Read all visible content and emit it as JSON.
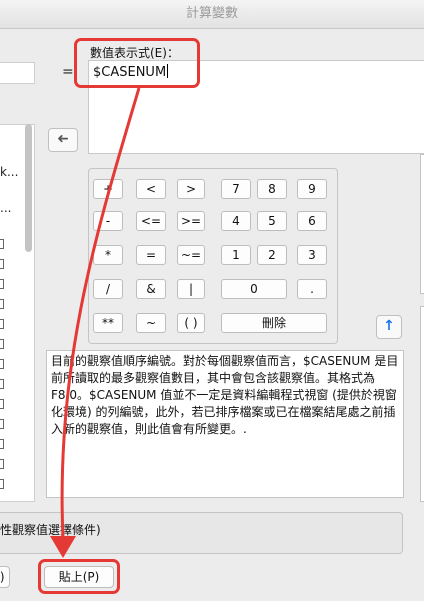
{
  "window": {
    "title": "計算變數"
  },
  "expression": {
    "label": "數值表示式(E)：",
    "value": "$CASENUM",
    "equals": "="
  },
  "variables": {
    "items": [
      "k...",
      "..."
    ]
  },
  "keypad": {
    "keys": [
      "+",
      "<",
      ">",
      "7",
      "8",
      "9",
      "-",
      "<=",
      ">=",
      "4",
      "5",
      "6",
      "*",
      "=",
      "~=",
      "1",
      "2",
      "3",
      "/",
      "&",
      "|",
      "0",
      ".",
      "**",
      "~",
      "( )",
      "刪除"
    ]
  },
  "description": {
    "text": "目前的觀察值順序編號。對於每個觀察值而言，$CASENUM 是目前所讀取的最多觀察值數目，其中會包含該觀察值。其格式為 F8.0。$CASENUM 值並不一定是資料編輯程式視窗 (提供於視窗化環境) 的列編號，此外，若已排序檔案或已在檔案結尾處之前插入新的觀察值，則此值會有所變更。."
  },
  "if_condition": {
    "label": "性觀察值選擇條件)"
  },
  "buttons": {
    "left_partial": "R)",
    "paste": "貼上(P)"
  },
  "icons": {
    "move_arrow": "left-arrow-icon",
    "up_arrow": "up-arrow-icon"
  },
  "colors": {
    "highlight": "#e53935",
    "up_arrow": "#1a73e8"
  }
}
